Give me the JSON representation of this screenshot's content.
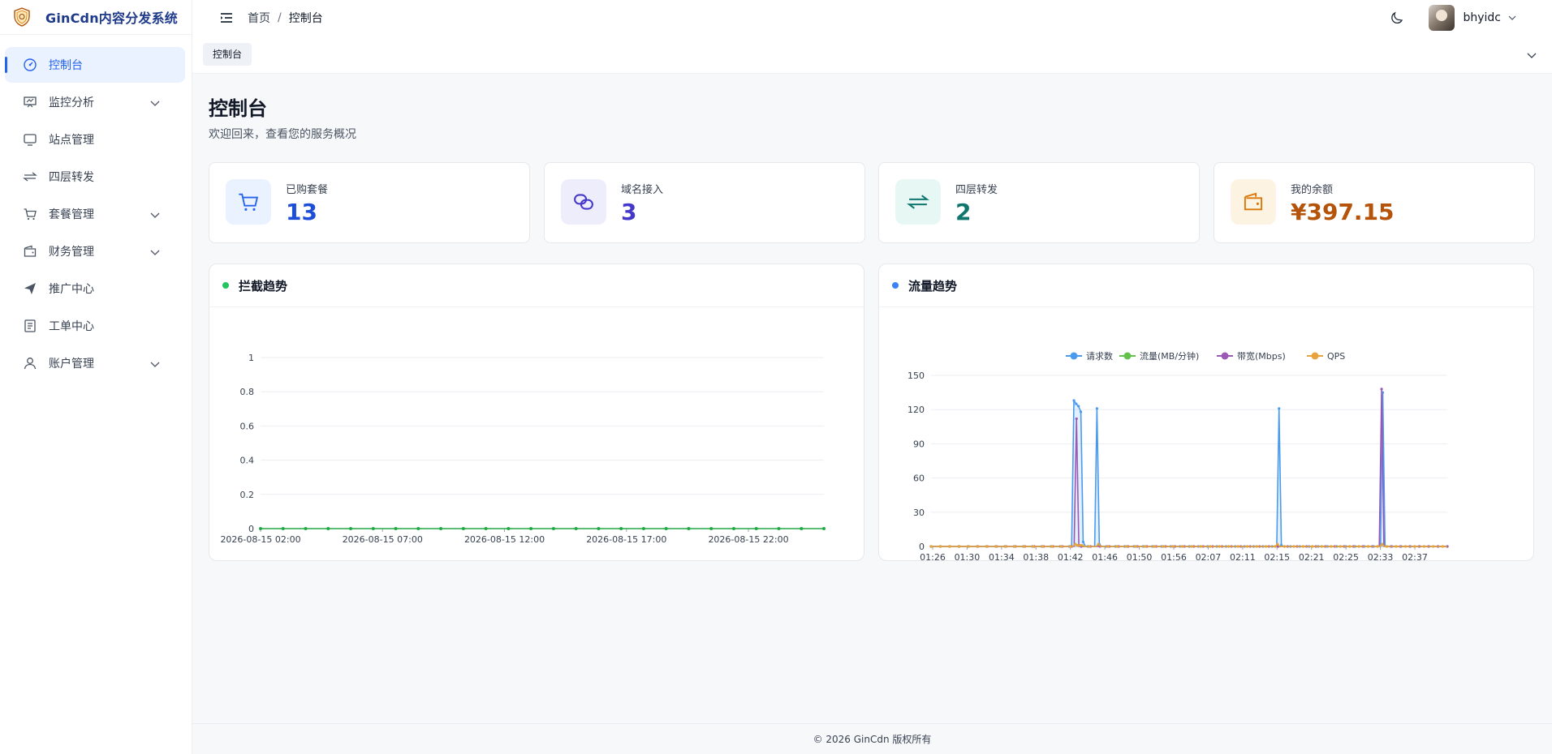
{
  "app": {
    "brand_title": "GinCdn内容分发系统",
    "accent": "#2563eb"
  },
  "sidebar": {
    "items": [
      {
        "label": "控制台",
        "icon": "dashboard-icon",
        "active": true
      },
      {
        "label": "监控分析",
        "icon": "monitor-analysis-icon",
        "expandable": true
      },
      {
        "label": "站点管理",
        "icon": "monitor-icon"
      },
      {
        "label": "四层转发",
        "icon": "swap-arrows-icon"
      },
      {
        "label": "套餐管理",
        "icon": "cart-icon",
        "expandable": true
      },
      {
        "label": "财务管理",
        "icon": "wallet-icon",
        "expandable": true
      },
      {
        "label": "推广中心",
        "icon": "paper-plane-icon"
      },
      {
        "label": "工单中心",
        "icon": "ticket-icon"
      },
      {
        "label": "账户管理",
        "icon": "user-icon",
        "expandable": true
      }
    ]
  },
  "header": {
    "breadcrumb": [
      "首页",
      "控制台"
    ],
    "username": "bhyidc"
  },
  "tabs": [
    {
      "label": "控制台"
    }
  ],
  "main": {
    "title": "控制台",
    "subtitle": "欢迎回来，查看您的服务概况",
    "stats": [
      {
        "label": "已购套餐",
        "value": "13",
        "icon": "cart-icon",
        "color": "#1d4ed8",
        "bg": "#eaf1ff"
      },
      {
        "label": "域名接入",
        "value": "3",
        "icon": "link-icon",
        "color": "#4338ca",
        "bg": "#eeedfb"
      },
      {
        "label": "四层转发",
        "value": "2",
        "icon": "swap-arrows-icon",
        "color": "#0f766e",
        "bg": "#e6f7f4"
      },
      {
        "label": "我的余额",
        "value": "¥397.15",
        "icon": "wallet-icon",
        "color": "#b45309",
        "bg": "#fdf3e3"
      }
    ]
  },
  "chart_data": [
    {
      "type": "line",
      "title": "拦截趋势",
      "title_dot_color": "#22c55e",
      "x_tick_labels": [
        "2026-08-15 02:00",
        "2026-08-15 07:00",
        "2026-08-15 12:00",
        "2026-08-15 17:00",
        "2026-08-15 22:00"
      ],
      "ylim": [
        0,
        1
      ],
      "y_ticks": [
        0,
        0.2,
        0.4,
        0.6,
        0.8,
        1
      ],
      "grid": true,
      "series": [
        {
          "color": "#22a845",
          "values": [
            0,
            0,
            0,
            0,
            0,
            0,
            0,
            0,
            0,
            0,
            0,
            0,
            0,
            0,
            0,
            0,
            0,
            0,
            0,
            0,
            0,
            0,
            0,
            0,
            0,
            0
          ]
        }
      ]
    },
    {
      "type": "line",
      "title": "流量趋势",
      "title_dot_color": "#3b82f6",
      "legend_position": "top-center",
      "x_tick_labels": [
        "01:26",
        "01:30",
        "01:34",
        "01:38",
        "01:42",
        "01:46",
        "01:50",
        "01:56",
        "02:07",
        "02:11",
        "02:15",
        "02:21",
        "02:25",
        "02:33",
        "02:37"
      ],
      "ylim": [
        0,
        150
      ],
      "y_ticks": [
        0,
        30,
        60,
        90,
        120,
        150
      ],
      "grid": true,
      "series": [
        {
          "name": "请求数",
          "color": "#4a9bf0",
          "area": true,
          "values": [
            0,
            0,
            0,
            0,
            0,
            0,
            0,
            0,
            0,
            0,
            0,
            0,
            0,
            0,
            0,
            0,
            0,
            0,
            0,
            0,
            0,
            0,
            0,
            0,
            0,
            0,
            0,
            0,
            0,
            0,
            0,
            0,
            0,
            0,
            0,
            0,
            0,
            0,
            0,
            0,
            0,
            0,
            0,
            0,
            0,
            0,
            0,
            0,
            0,
            0,
            0,
            0,
            0,
            0,
            0,
            0,
            0,
            0,
            0,
            0,
            0,
            0,
            128,
            125,
            123,
            118,
            4,
            0,
            0,
            0,
            0,
            0,
            121,
            2,
            0,
            0,
            0,
            0,
            0,
            0,
            0,
            0,
            0,
            0,
            0,
            0,
            0,
            0,
            0,
            0,
            0,
            0,
            0,
            0,
            0,
            0,
            0,
            0,
            0,
            0,
            0,
            0,
            0,
            0,
            0,
            0,
            0,
            0,
            0,
            0,
            0,
            0,
            0,
            0,
            0,
            0,
            0,
            0,
            0,
            0,
            0,
            0,
            0,
            0,
            0,
            0,
            0,
            0,
            0,
            0,
            0,
            0,
            0,
            0,
            0,
            0,
            0,
            0,
            0,
            0,
            0,
            0,
            0,
            0,
            0,
            0,
            0,
            0,
            0,
            0,
            0,
            121,
            1,
            0,
            0,
            0,
            0,
            0,
            0,
            0,
            0,
            0,
            0,
            0,
            0,
            0,
            0,
            0,
            0,
            0,
            0,
            0,
            0,
            0,
            0,
            0,
            0,
            0,
            0,
            0,
            0,
            0,
            0,
            0,
            0,
            0,
            0,
            0,
            0,
            0,
            0,
            0,
            0,
            0,
            0,
            0,
            135,
            0,
            0,
            0,
            0,
            0,
            0,
            0,
            0,
            0,
            0,
            0,
            0,
            0,
            0,
            0,
            0,
            0,
            0,
            0,
            0,
            0,
            0,
            0,
            0,
            0,
            0,
            0,
            0
          ]
        },
        {
          "name": "流量(MB/分钟)",
          "color": "#63c04a",
          "values": [
            0,
            0,
            0,
            0,
            0,
            0,
            0,
            0,
            0,
            0,
            0,
            0,
            0,
            0,
            0,
            0,
            0,
            0,
            0,
            0,
            0,
            0,
            0,
            0,
            0,
            0,
            0,
            0,
            0,
            0,
            0,
            0,
            0,
            0,
            0,
            0,
            0,
            0,
            0,
            0,
            0,
            0,
            0,
            0,
            0,
            0,
            0,
            0,
            0,
            0,
            0,
            0,
            0,
            0,
            0,
            0,
            0,
            0,
            0,
            0,
            0,
            0,
            2,
            1,
            1,
            0,
            0,
            0,
            0,
            0,
            0,
            0,
            1,
            0,
            0,
            0,
            0,
            0,
            0,
            0,
            0,
            0,
            0,
            0,
            0,
            0,
            0,
            0,
            0,
            0,
            0,
            0,
            0,
            0,
            0,
            0,
            0,
            0,
            0,
            0,
            0,
            0,
            0,
            0,
            0,
            0,
            0,
            0,
            0,
            0,
            0,
            0,
            0,
            0,
            0,
            0,
            0,
            0,
            0,
            0,
            0,
            0,
            0,
            0,
            0,
            0,
            0,
            0,
            0,
            0,
            0,
            0,
            0,
            0,
            0,
            0,
            0,
            0,
            0,
            0,
            0,
            0,
            0,
            0,
            0,
            0,
            0,
            0,
            0,
            1,
            0,
            0,
            0,
            0,
            0,
            0,
            0,
            0,
            0,
            0,
            0,
            0,
            0,
            0,
            0,
            0,
            0,
            0,
            0,
            0,
            0,
            0,
            0,
            0,
            0,
            0,
            0,
            0,
            0,
            0,
            0,
            0,
            0,
            0,
            0,
            0,
            0,
            0,
            0,
            0,
            0,
            0,
            0,
            0,
            2,
            0,
            0,
            0,
            0,
            0,
            0,
            0,
            0,
            0,
            0,
            0,
            0,
            0,
            0,
            0,
            0,
            0,
            0,
            0,
            0,
            0,
            0,
            0,
            0,
            0,
            0,
            0,
            0
          ]
        },
        {
          "name": "带宽(Mbps)",
          "color": "#9b59b6",
          "values": [
            0,
            0,
            0,
            0,
            0,
            0,
            0,
            0,
            0,
            0,
            0,
            0,
            0,
            0,
            0,
            0,
            0,
            0,
            0,
            0,
            0,
            0,
            0,
            0,
            0,
            0,
            0,
            0,
            0,
            0,
            0,
            0,
            0,
            0,
            0,
            0,
            0,
            0,
            0,
            0,
            0,
            0,
            0,
            0,
            0,
            0,
            0,
            0,
            0,
            0,
            0,
            0,
            0,
            0,
            0,
            0,
            0,
            0,
            0,
            0,
            0,
            0,
            112,
            0,
            0,
            0,
            0,
            0,
            0,
            0,
            0,
            0,
            0,
            0,
            0,
            0,
            0,
            0,
            0,
            0,
            0,
            0,
            0,
            0,
            0,
            0,
            0,
            0,
            0,
            0,
            0,
            0,
            0,
            0,
            0,
            0,
            0,
            0,
            0,
            0,
            0,
            0,
            0,
            0,
            0,
            0,
            0,
            0,
            0,
            0,
            0,
            0,
            0,
            0,
            0,
            0,
            0,
            0,
            0,
            0,
            0,
            0,
            0,
            0,
            0,
            0,
            0,
            0,
            0,
            0,
            0,
            0,
            0,
            0,
            0,
            0,
            0,
            0,
            0,
            0,
            0,
            0,
            0,
            0,
            0,
            0,
            0,
            0,
            0,
            0,
            0,
            0,
            0,
            0,
            0,
            0,
            0,
            0,
            0,
            0,
            0,
            0,
            0,
            0,
            0,
            0,
            0,
            0,
            0,
            0,
            0,
            0,
            0,
            0,
            0,
            0,
            0,
            0,
            0,
            0,
            0,
            0,
            0,
            0,
            0,
            0,
            0,
            0,
            0,
            0,
            0,
            0,
            138,
            0,
            0,
            0,
            0,
            0,
            0,
            0,
            0,
            0,
            0,
            0,
            0,
            0,
            0,
            0,
            0,
            0,
            0,
            0,
            0,
            0,
            0,
            0,
            0,
            0,
            0,
            0,
            0
          ]
        },
        {
          "name": "QPS",
          "color": "#e8a33d",
          "values": [
            0,
            0,
            0,
            0,
            0,
            0,
            0,
            0,
            0,
            0,
            0,
            0,
            0,
            0,
            0,
            0,
            0,
            0,
            0,
            0,
            0,
            0,
            0,
            0,
            0,
            0,
            0,
            0,
            0,
            0,
            0,
            0,
            0,
            0,
            0,
            0,
            0,
            0,
            0,
            0,
            0,
            0,
            0,
            0,
            0,
            0,
            0,
            0,
            0,
            0,
            0,
            0,
            0,
            0,
            0,
            0,
            0,
            0,
            0,
            0,
            0,
            0,
            2,
            1,
            1,
            1,
            0,
            0,
            0,
            0,
            0,
            0,
            2,
            0,
            0,
            0,
            0,
            0,
            0,
            0,
            0,
            0,
            0,
            0,
            0,
            0,
            0,
            0,
            0,
            0,
            0,
            0,
            0,
            0,
            0,
            0,
            0,
            0,
            0,
            0,
            0,
            0,
            0,
            0,
            0,
            0,
            0,
            0,
            0,
            0,
            0,
            0,
            0,
            0,
            0,
            0,
            0,
            0,
            0,
            0,
            0,
            0,
            0,
            0,
            0,
            0,
            0,
            0,
            0,
            0,
            0,
            0,
            0,
            0,
            0,
            0,
            0,
            0,
            0,
            0,
            0,
            0,
            0,
            0,
            0,
            0,
            0,
            0,
            0,
            2,
            0,
            0,
            0,
            0,
            0,
            0,
            0,
            0,
            0,
            0,
            0,
            0,
            0,
            0,
            0,
            0,
            0,
            0,
            0,
            0,
            0,
            0,
            0,
            0,
            0,
            0,
            0,
            0,
            0,
            0,
            0,
            0,
            0,
            0,
            0,
            0,
            0,
            0,
            0,
            0,
            0,
            0,
            0,
            0,
            2,
            0,
            0,
            0,
            0,
            0,
            0,
            0,
            0,
            0,
            0,
            0,
            0,
            0,
            0,
            0,
            0,
            0,
            0,
            0,
            0,
            0,
            0,
            0,
            0,
            0,
            0,
            0,
            0
          ]
        }
      ]
    }
  ],
  "footer": {
    "copyright": "© 2026 GinCdn 版权所有"
  }
}
